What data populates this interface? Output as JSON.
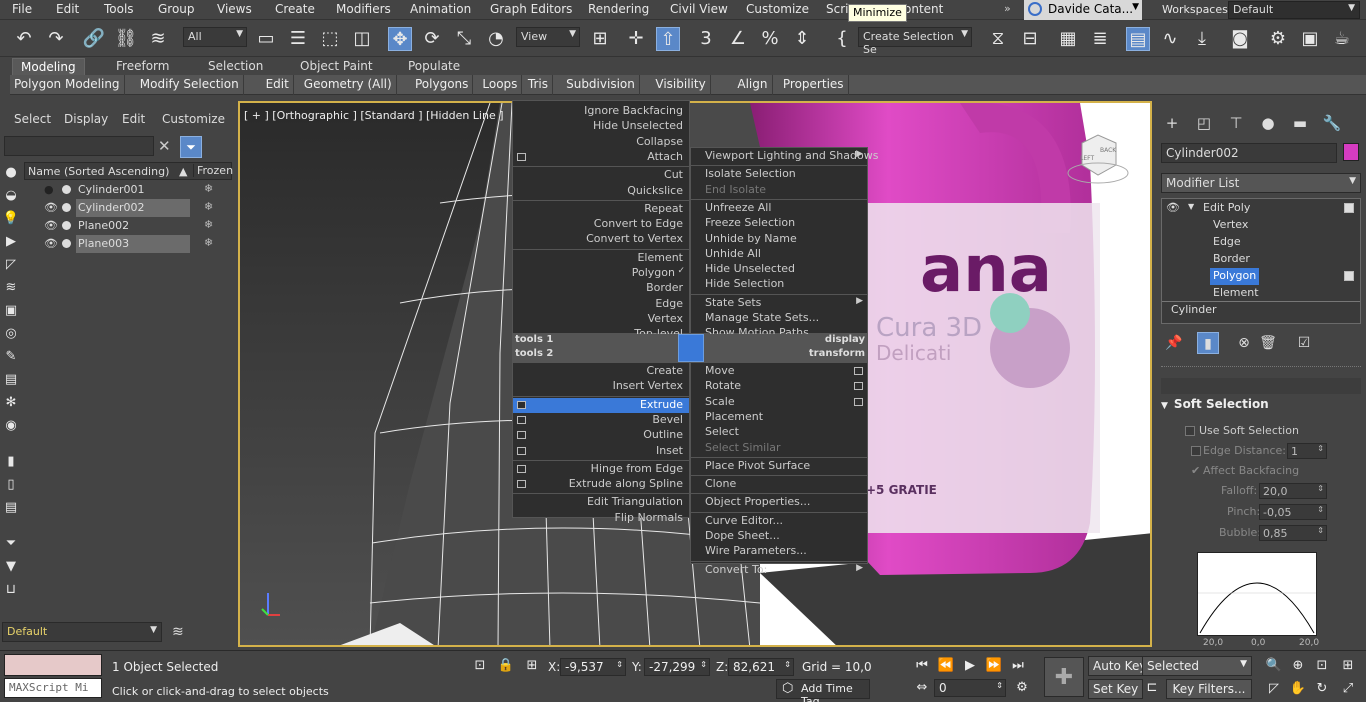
{
  "menubar": {
    "items": [
      "File",
      "Edit",
      "Tools",
      "Group",
      "Views",
      "Create",
      "Modifiers",
      "Animation",
      "Graph Editors",
      "Rendering",
      "Civil View",
      "Customize",
      "Scri",
      "ontent"
    ],
    "tooltip": "Minimize",
    "user_name": "Davide Cata...",
    "workspaces_label": "Workspaces:",
    "workspace_value": "Default"
  },
  "toolbar": {
    "filter_all": "All",
    "view_combo": "View",
    "create_selection_set": "Create Selection Se"
  },
  "ribbon": {
    "tabs": [
      "Modeling",
      "Freeform",
      "Selection",
      "Object Paint",
      "Populate"
    ],
    "active_tab": "Modeling",
    "sub_items": [
      "Polygon Modeling",
      "Modify Selection",
      "Edit",
      "Geometry (All)",
      "Polygons",
      "Loops",
      "Tris",
      "Subdivision",
      "Visibility",
      "Align",
      "Properties"
    ]
  },
  "scene_explorer": {
    "menu": [
      "Select",
      "Display",
      "Edit",
      "Customize"
    ],
    "column_name": "Name (Sorted Ascending)",
    "sort_arrow": "▲",
    "column_frozen": "Frozen",
    "rows": [
      {
        "name": "Cylinder001",
        "visible": false,
        "selected": false
      },
      {
        "name": "Cylinder002",
        "visible": true,
        "selected": true
      },
      {
        "name": "Plane002",
        "visible": true,
        "selected": false
      },
      {
        "name": "Plane003",
        "visible": true,
        "selected": true
      }
    ],
    "layer": "Default"
  },
  "viewport": {
    "label": "[ + ] [Orthographic ] [Standard ] [Hidden Line ]",
    "bottle_text": "ana",
    "bottle_sub": "Cura 3D",
    "bottle_sub2": "Delicati",
    "bottle_promo": "+5 GRATIE",
    "viewcube_front": "LEFT",
    "viewcube_top": "BACK"
  },
  "quad_menu": {
    "tl": [
      {
        "label": "Ignore Backfacing",
        "box": false
      },
      {
        "label": "Hide Unselected",
        "box": false
      },
      {
        "label": "Collapse",
        "box": false
      },
      {
        "label": "Attach",
        "box": true
      },
      {
        "label": "Cut",
        "box": false
      },
      {
        "label": "Quickslice",
        "box": false
      },
      {
        "label": "Repeat",
        "box": false
      },
      {
        "label": "Convert to Edge",
        "box": false
      },
      {
        "label": "Convert to Vertex",
        "box": false
      },
      {
        "label": "Element",
        "box": false
      },
      {
        "label": "Polygon",
        "box": false,
        "check": true
      },
      {
        "label": "Border",
        "box": false
      },
      {
        "label": "Edge",
        "box": false
      },
      {
        "label": "Vertex",
        "box": false
      },
      {
        "label": "Top-level",
        "box": false
      }
    ],
    "tr": [
      {
        "label": "Viewport Lighting and Shadows",
        "arrow": true
      },
      {
        "label": "Isolate Selection"
      },
      {
        "label": "End Isolate",
        "disabled": true
      },
      {
        "label": "Unfreeze All"
      },
      {
        "label": "Freeze Selection"
      },
      {
        "label": "Unhide by Name"
      },
      {
        "label": "Unhide All"
      },
      {
        "label": "Hide Unselected"
      },
      {
        "label": "Hide Selection"
      },
      {
        "label": "State Sets",
        "arrow": true
      },
      {
        "label": "Manage State Sets..."
      },
      {
        "label": "Show Motion Paths"
      }
    ],
    "headers": {
      "tools1": "tools 1",
      "tools2": "tools 2",
      "display": "display",
      "transform": "transform"
    },
    "bl": [
      {
        "label": "Create",
        "box": false
      },
      {
        "label": "Insert Vertex",
        "box": false
      },
      {
        "label": "Extrude",
        "box": true,
        "highlight": true
      },
      {
        "label": "Bevel",
        "box": true
      },
      {
        "label": "Outline",
        "box": true
      },
      {
        "label": "Inset",
        "box": true
      },
      {
        "label": "Hinge from Edge",
        "box": true
      },
      {
        "label": "Extrude along Spline",
        "box": true
      },
      {
        "label": "Edit Triangulation",
        "box": false
      },
      {
        "label": "Flip Normals",
        "box": false
      }
    ],
    "br": [
      {
        "label": "Move",
        "box": true
      },
      {
        "label": "Rotate",
        "box": true
      },
      {
        "label": "Scale",
        "box": true
      },
      {
        "label": "Placement"
      },
      {
        "label": "Select"
      },
      {
        "label": "Select Similar",
        "disabled": true
      },
      {
        "label": "Place Pivot Surface"
      },
      {
        "label": "Clone"
      },
      {
        "label": "Object Properties..."
      },
      {
        "label": "Curve Editor..."
      },
      {
        "label": "Dope Sheet..."
      },
      {
        "label": "Wire Parameters..."
      },
      {
        "label": "Convert To:",
        "arrow": true
      }
    ]
  },
  "command_panel": {
    "object_name": "Cylinder002",
    "object_color": "#d63cc1",
    "modifier_list": "Modifier List",
    "stack": [
      {
        "label": "Edit Poly",
        "level": 0,
        "expanded": true
      },
      {
        "label": "Vertex",
        "level": 1
      },
      {
        "label": "Edge",
        "level": 1
      },
      {
        "label": "Border",
        "level": 1
      },
      {
        "label": "Polygon",
        "level": 1,
        "selected": true
      },
      {
        "label": "Element",
        "level": 1
      },
      {
        "label": "Cylinder",
        "level": -1
      }
    ],
    "soft_selection": {
      "title": "Soft Selection",
      "use_soft_selection": "Use Soft Selection",
      "edge_distance": "Edge Distance:",
      "edge_distance_value": "1",
      "affect_backfacing": "Affect Backfacing",
      "falloff_label": "Falloff:",
      "falloff_value": "20,0",
      "pinch_label": "Pinch:",
      "pinch_value": "-0,05",
      "bubble_label": "Bubble:",
      "bubble_value": "0,85",
      "curve_axis": [
        "20,0",
        "0,0",
        "20,0"
      ]
    }
  },
  "status": {
    "maxscript_placeholder": "MAXScript Mi",
    "selection_count": "1 Object Selected",
    "prompt": "Click or click-and-drag to select objects",
    "x_label": "X:",
    "x_value": "-9,537",
    "y_label": "Y:",
    "y_value": "-27,299",
    "z_label": "Z:",
    "z_value": "82,621",
    "grid": "Grid = 10,0",
    "add_time_tag": "Add Time Tag",
    "auto_key": "Auto Key",
    "set_key": "Set Key",
    "key_filters": "Key Filters...",
    "selected_combo": "Selected",
    "frame": "0"
  }
}
